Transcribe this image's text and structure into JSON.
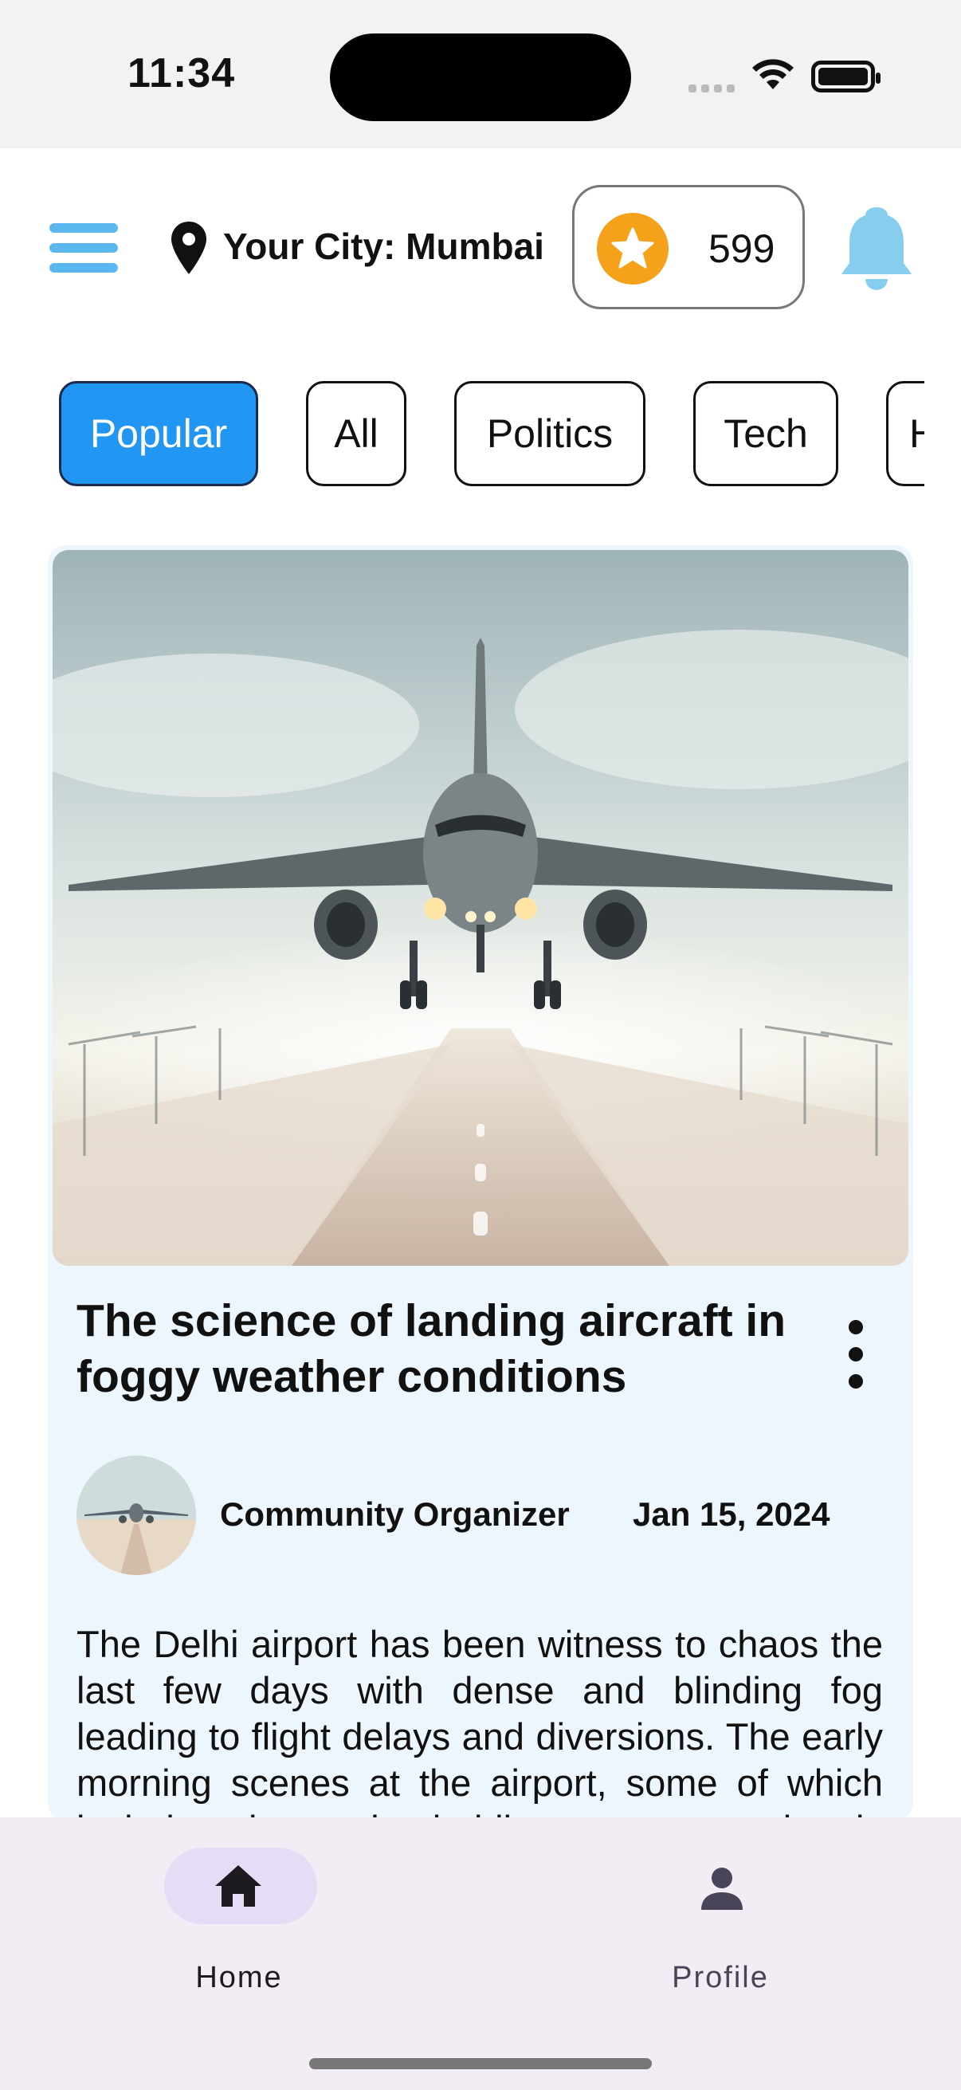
{
  "status_bar": {
    "time": "11:34"
  },
  "header": {
    "menu_icon": "menu-icon",
    "location_icon": "location-pin-icon",
    "city_label": "Your City: Mumbai",
    "coins": "599",
    "coin_icon": "star-coin-icon",
    "notification_icon": "bell-icon",
    "accent_color": "#5bb8ee",
    "coin_color": "#f6a11a"
  },
  "categories": {
    "items": [
      "Popular",
      "All",
      "Politics",
      "Tech",
      "H"
    ],
    "selected": "Popular",
    "active_color": "#2196f3"
  },
  "article": {
    "title": "The science of landing aircraft in foggy weather conditions",
    "author": "Community Organizer",
    "date": "Jan 15, 2024",
    "excerpt": "The Delhi airport has been witness to chaos the last few days with dense and blinding fog leading to flight delays and diversions. The early morning scenes at the airport, some of which include planes in holding patterns, chaotic terminals and",
    "card_bg": "#edf5fd"
  },
  "bottom_nav": {
    "items": [
      {
        "label": "Home",
        "icon": "home-icon",
        "active": true
      },
      {
        "label": "Profile",
        "icon": "person-icon",
        "active": false
      }
    ],
    "active_pill_color": "#e6dcf5"
  }
}
